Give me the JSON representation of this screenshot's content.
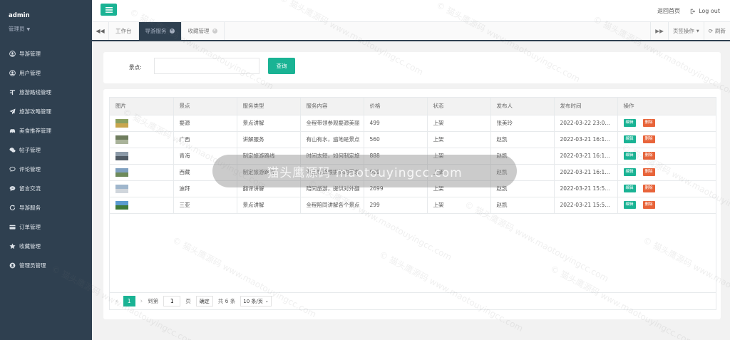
{
  "sidebar": {
    "username": "admin",
    "role": "管理员",
    "items": [
      {
        "label": "导游管理",
        "icon": "user-circle-icon"
      },
      {
        "label": "用户管理",
        "icon": "user-circle-icon"
      },
      {
        "label": "旅游路线管理",
        "icon": "route-icon"
      },
      {
        "label": "旅游攻略管理",
        "icon": "paper-plane-icon"
      },
      {
        "label": "美食推荐管理",
        "icon": "car-icon"
      },
      {
        "label": "帖子管理",
        "icon": "comments-icon"
      },
      {
        "label": "评论管理",
        "icon": "comment-icon"
      },
      {
        "label": "留言交流",
        "icon": "comment-dots-icon"
      },
      {
        "label": "导游服务",
        "icon": "refresh-icon"
      },
      {
        "label": "订单管理",
        "icon": "credit-card-icon"
      },
      {
        "label": "收藏管理",
        "icon": "star-icon"
      },
      {
        "label": "管理员管理",
        "icon": "user-icon"
      }
    ]
  },
  "topbar": {
    "home_link": "返回首页",
    "logout": "Log out"
  },
  "tabs": {
    "items": [
      {
        "label": "工作台"
      },
      {
        "label": "导游服务"
      },
      {
        "label": "收藏管理"
      }
    ],
    "page_ops": "页签操作",
    "refresh": "刷新"
  },
  "search": {
    "label": "景点:",
    "value": "",
    "button": "查询"
  },
  "table": {
    "headers": [
      "图片",
      "景点",
      "服务类型",
      "服务内容",
      "价格",
      "状态",
      "发布人",
      "发布时间",
      "操作"
    ],
    "rows": [
      {
        "spot": "婺源",
        "type": "景点讲解",
        "content": "全程带领参观婺源美丽",
        "price": "499",
        "status": "上架",
        "publisher": "张美玲",
        "time": "2022-03-22 23:0...",
        "thumb": [
          "#8aa060",
          "#c9a64d"
        ]
      },
      {
        "spot": "广西",
        "type": "讲解服务",
        "content": "有山有水，遍地是景点",
        "price": "560",
        "status": "上架",
        "publisher": "赵凯",
        "time": "2022-03-21 16:1...",
        "thumb": [
          "#6f7d5e",
          "#a9b39a"
        ]
      },
      {
        "spot": "青海",
        "type": "制定旅游路线",
        "content": "时间太短，如何制定旅",
        "price": "888",
        "status": "上架",
        "publisher": "赵凯",
        "time": "2022-03-21 16:1...",
        "thumb": [
          "#8c9aa8",
          "#505a64"
        ]
      },
      {
        "spot": "西藏",
        "type": "制定旅游路线",
        "content": "专业导游根据你的需求",
        "price": "999",
        "status": "上架",
        "publisher": "赵凯",
        "time": "2022-03-21 16:1...",
        "thumb": [
          "#7fa0c0",
          "#6e8a5a"
        ]
      },
      {
        "spot": "迪拜",
        "type": "翻译讲解",
        "content": "陪同旅游，提供对外翻",
        "price": "2699",
        "status": "上架",
        "publisher": "赵凯",
        "time": "2022-03-21 15:5...",
        "thumb": [
          "#9fb6cc",
          "#d0d6dc"
        ]
      },
      {
        "spot": "三亚",
        "type": "景点讲解",
        "content": "全程陪同讲解各个景点",
        "price": "299",
        "status": "上架",
        "publisher": "赵凯",
        "time": "2022-03-21 15:5...",
        "thumb": [
          "#5a9bd0",
          "#3f7a3a"
        ]
      }
    ],
    "edit_label": "编辑",
    "delete_label": "删除"
  },
  "pager": {
    "current": "1",
    "goto_label": "到第",
    "goto_value": "1",
    "page_unit": "页",
    "confirm": "确定",
    "total": "共 6 条",
    "page_size": "10 条/页"
  },
  "watermark": {
    "banner": "猫头鹰源码 maotouyingcc.com",
    "text": "© 猫头鹰源码 www.maotouyingcc.com"
  },
  "colors": {
    "accent": "#1ab394",
    "sidebar": "#2f4050",
    "danger": "#e8643a"
  }
}
